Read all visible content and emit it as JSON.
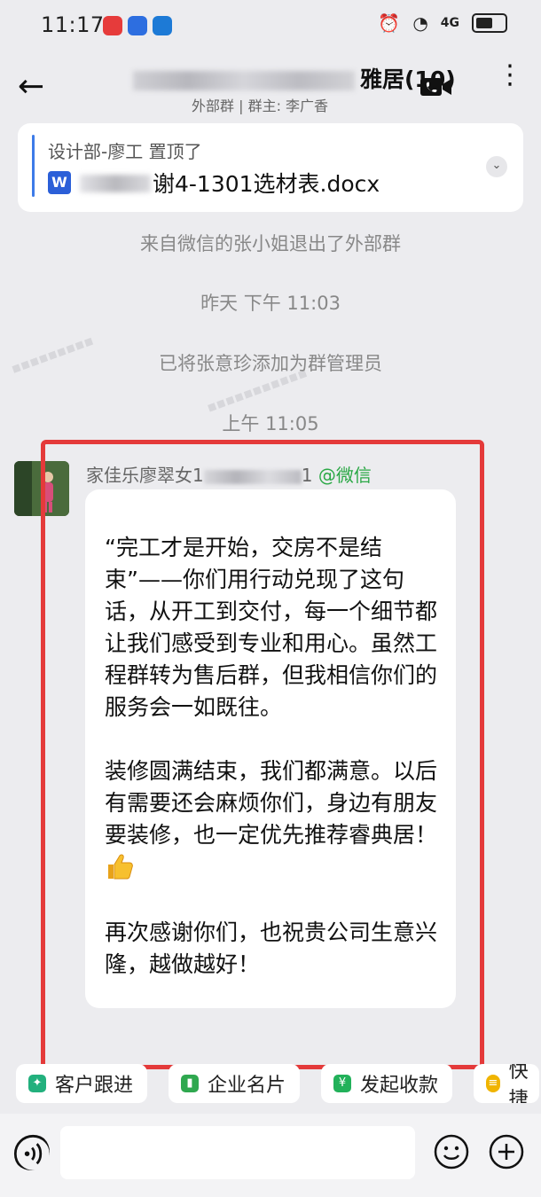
{
  "status": {
    "time": "11:17",
    "network": "4G"
  },
  "header": {
    "back": "←",
    "title_suffix": "雅居(10)",
    "subtitle": "外部群 | 群主: 李广香"
  },
  "pinned": {
    "line1": "设计部-廖工 置顶了",
    "file_badge": "W",
    "file_name": "谢4-1301选材表.docx"
  },
  "system": {
    "left_group": "来自微信的张小姐退出了外部群",
    "time1": "昨天  下午 11:03",
    "admin_added": "已将张意珍添加为群管理员",
    "time2": "上午 11:05"
  },
  "message": {
    "sender_prefix": "家佳乐廖翠女1",
    "sender_suffix": "1",
    "sender_source": "@微信",
    "text": "“完工才是开始，交房不是结束”——你们用行动兑现了这句话，从开工到交付，每一个细节都让我们感受到专业和用心。虽然工程群转为售后群，但我相信你们的服务会一如既往。\n\n装修圆满结束，我们都满意。以后有需要还会麻烦你们，身边有朋友要装修，也一定优先推荐睿典居！",
    "text_end": "\n\n再次感谢你们，也祝贵公司生意兴隆，越做越好！"
  },
  "quick_actions": [
    {
      "label": "客户跟进",
      "color": "#22b07d"
    },
    {
      "label": "企业名片",
      "color": "#2fa84f"
    },
    {
      "label": "发起收款",
      "color": "#22b15a"
    },
    {
      "label": "快捷",
      "color": "#f0b400"
    }
  ]
}
